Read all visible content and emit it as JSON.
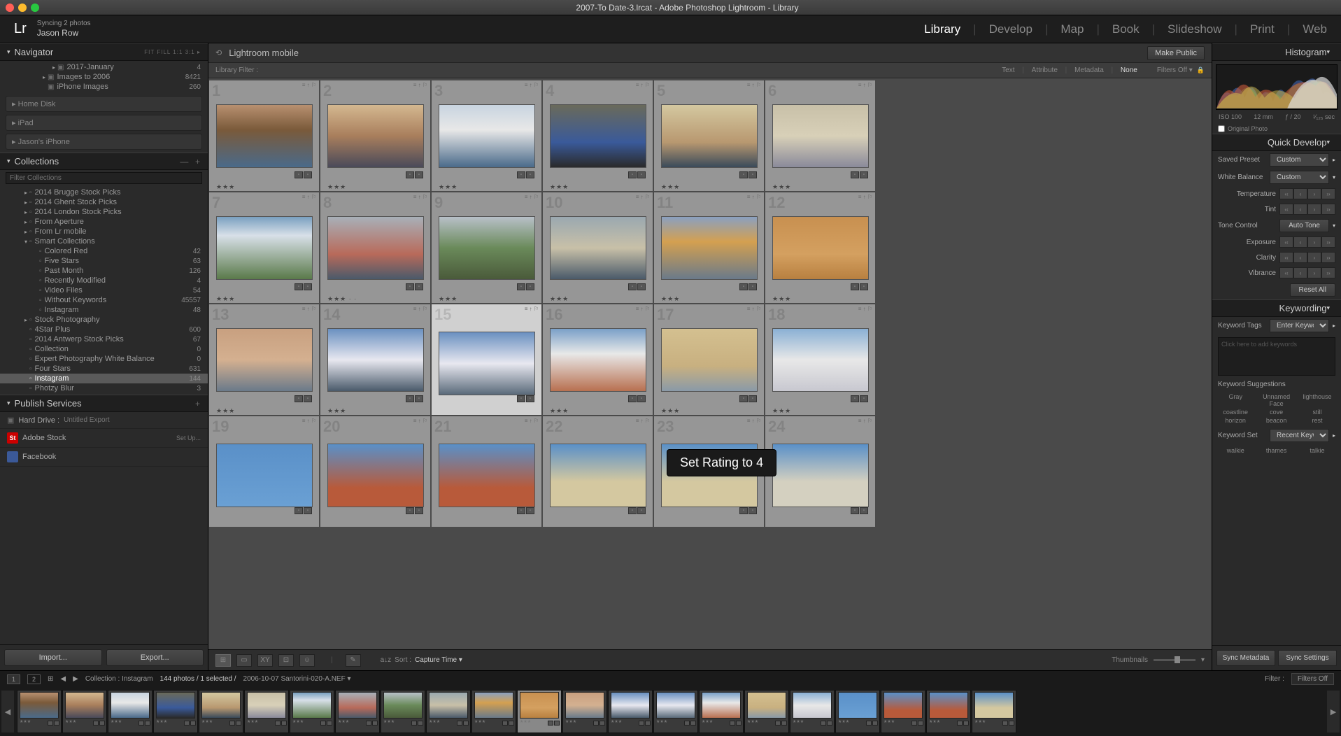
{
  "titlebar": {
    "title": "2007-To Date-3.lrcat - Adobe Photoshop Lightroom - Library"
  },
  "traffic_colors": {
    "close": "#ff5f57",
    "min": "#febc2e",
    "max": "#28c840"
  },
  "identity": {
    "sync": "Syncing 2 photos",
    "name": "Jason Row"
  },
  "logo": "Lr",
  "modules": [
    "Library",
    "Develop",
    "Map",
    "Book",
    "Slideshow",
    "Print",
    "Web"
  ],
  "active_module": "Library",
  "navigator": {
    "title": "Navigator",
    "extras": "FIT  FILL  1:1  3:1 ▸"
  },
  "folders": [
    {
      "indent": 3,
      "arrow": "▸",
      "label": "2017-January",
      "count": "4"
    },
    {
      "indent": 2,
      "arrow": "▸",
      "label": "Images to 2006",
      "count": "8421"
    },
    {
      "indent": 2,
      "arrow": "",
      "label": "iPhone Images",
      "count": "260"
    }
  ],
  "wells": [
    "Home Disk",
    "iPad",
    "Jason's iPhone"
  ],
  "collections": {
    "title": "Collections",
    "filter_placeholder": "Filter Collections",
    "items": [
      {
        "indent": 1,
        "arrow": "▸",
        "label": "2014 Brugge Stock Picks",
        "count": ""
      },
      {
        "indent": 1,
        "arrow": "▸",
        "label": "2014 Ghent Stock Picks",
        "count": ""
      },
      {
        "indent": 1,
        "arrow": "▸",
        "label": "2014 London Stock Picks",
        "count": ""
      },
      {
        "indent": 1,
        "arrow": "▸",
        "label": "From Aperture",
        "count": ""
      },
      {
        "indent": 1,
        "arrow": "▸",
        "label": "From Lr mobile",
        "count": ""
      },
      {
        "indent": 1,
        "arrow": "▾",
        "label": "Smart Collections",
        "count": ""
      },
      {
        "indent": 2,
        "arrow": "",
        "label": "Colored Red",
        "count": "42"
      },
      {
        "indent": 2,
        "arrow": "",
        "label": "Five Stars",
        "count": "63"
      },
      {
        "indent": 2,
        "arrow": "",
        "label": "Past Month",
        "count": "126"
      },
      {
        "indent": 2,
        "arrow": "",
        "label": "Recently Modified",
        "count": "4"
      },
      {
        "indent": 2,
        "arrow": "",
        "label": "Video Files",
        "count": "54"
      },
      {
        "indent": 2,
        "arrow": "",
        "label": "Without Keywords",
        "count": "45557"
      },
      {
        "indent": 2,
        "arrow": "",
        "label": "Instagram",
        "count": "48"
      },
      {
        "indent": 1,
        "arrow": "▸",
        "label": "Stock Photography",
        "count": ""
      },
      {
        "indent": 1,
        "arrow": "",
        "label": "4Star Plus",
        "count": "600"
      },
      {
        "indent": 1,
        "arrow": "",
        "label": "2014 Antwerp Stock Picks",
        "count": "67"
      },
      {
        "indent": 1,
        "arrow": "",
        "label": "Collection",
        "count": "0"
      },
      {
        "indent": 1,
        "arrow": "",
        "label": "Expert Photography White Balance",
        "count": "0"
      },
      {
        "indent": 1,
        "arrow": "",
        "label": "Four Stars",
        "count": "631"
      },
      {
        "indent": 1,
        "arrow": "",
        "label": "Instagram",
        "count": "144",
        "selected": true
      },
      {
        "indent": 1,
        "arrow": "",
        "label": "Photzy Blur",
        "count": "3"
      }
    ]
  },
  "publish": {
    "title": "Publish Services",
    "items": [
      {
        "label": "Hard Drive :",
        "sub": "Untitled Export"
      },
      {
        "label": "Adobe Stock",
        "setup": "Set Up..."
      },
      {
        "label": "Facebook",
        "sub": ""
      }
    ]
  },
  "import_btn": "Import...",
  "export_btn": "Export...",
  "crumb": {
    "back_icon": "⟲",
    "text": "Lightroom mobile",
    "make_public": "Make Public"
  },
  "library_filter": {
    "label": "Library Filter :",
    "opts": [
      "Text",
      "Attribute",
      "Metadata",
      "None"
    ],
    "active": "None",
    "filters_off": "Filters Off ▾"
  },
  "thumbs": [
    {
      "n": 1,
      "g": "linear-gradient(#b89070,#7a5a3a 40%,#4a6a8a)",
      "stars": "★★★"
    },
    {
      "n": 2,
      "g": "linear-gradient(#d4b890,#a87e5c 50%,#4a4a5a)",
      "stars": "★★★"
    },
    {
      "n": 3,
      "g": "linear-gradient(#c8d4e0,#e8e8e8 40%,#4a6a8a)",
      "stars": "★★★"
    },
    {
      "n": 4,
      "g": "linear-gradient(#6a6a5a,#3a5a9a 60%,#2a2a2a)",
      "stars": "★★★"
    },
    {
      "n": 5,
      "g": "linear-gradient(#d4c8a0,#b89870 60%,#3a4a5a)",
      "stars": "★★★"
    },
    {
      "n": 6,
      "g": "linear-gradient(#c8c0a8,#d8d0b8 50%,#8a8a9a)",
      "stars": "★★★"
    },
    {
      "n": 7,
      "g": "linear-gradient(#7aa0c0,#d8e0e8 30%,#5a7a4a)",
      "stars": "★★★"
    },
    {
      "n": 8,
      "g": "linear-gradient(#a8b0b8,#b86a5a 60%,#4a5a6a)",
      "stars": "★★★ · ·"
    },
    {
      "n": 9,
      "g": "linear-gradient(#b8c0c8,#6a8a5a 50%,#4a5a3a)",
      "stars": "★★★"
    },
    {
      "n": 10,
      "g": "linear-gradient(#9aa8b0,#c8c0a8 50%,#4a5a6a)",
      "stars": "★★★"
    },
    {
      "n": 11,
      "g": "linear-gradient(#8aa0c0,#d4a050 40%,#6a7a8a)",
      "stars": "★★★"
    },
    {
      "n": 12,
      "g": "linear-gradient(#c89050,#d4a060 60%,#b88040)",
      "stars": "★★★"
    },
    {
      "n": 13,
      "g": "linear-gradient(#c8a080,#d4b090 50%,#6a7a8a)",
      "stars": "★★★"
    },
    {
      "n": 14,
      "g": "linear-gradient(#6a90c0,#e8e8f0 50%,#4a5a6a)",
      "stars": "★★★"
    },
    {
      "n": 15,
      "g": "linear-gradient(#6a90c0,#e8e8f0 50%,#5a6a7a)",
      "stars": "",
      "selected": true
    },
    {
      "n": 16,
      "g": "linear-gradient(#7aa0c8,#e8e8e8 40%,#b87050)",
      "stars": "★★★"
    },
    {
      "n": 17,
      "g": "linear-gradient(#d4c090,#c8b080 60%,#8a9aa8)",
      "stars": "★★★"
    },
    {
      "n": 18,
      "g": "linear-gradient(#8ab0d4,#e8e8e8 50%,#c8c8d0)",
      "stars": "★★★"
    },
    {
      "n": 19,
      "g": "linear-gradient(#5a90c8,#6aa0d4)",
      "stars": ""
    },
    {
      "n": 20,
      "g": "linear-gradient(#5a90c8,#b85a3a 70%)",
      "stars": ""
    },
    {
      "n": 21,
      "g": "linear-gradient(#5a90c8,#b85a3a 70%)",
      "stars": ""
    },
    {
      "n": 22,
      "g": "linear-gradient(#5a90c8,#d4c8a0 60%)",
      "stars": ""
    },
    {
      "n": 23,
      "g": "linear-gradient(#5a90c8,#d4c8a0 60%)",
      "stars": ""
    },
    {
      "n": 24,
      "g": "linear-gradient(#5a90c8,#d4d0c0 60%)",
      "stars": ""
    }
  ],
  "tooltip": "Set Rating to 4",
  "bottom_toolbar": {
    "sort_label": "Sort :",
    "sort_value": "Capture Time",
    "thumbnails": "Thumbnails"
  },
  "status": {
    "monitors": [
      "1",
      "2"
    ],
    "collection": "Collection : Instagram",
    "count": "144 photos / 1 selected /",
    "file": "2006-10-07 Santorini-020-A.NEF ▾",
    "filter_label": "Filter :",
    "filter_value": "Filters Off"
  },
  "filmstrip_count": 22,
  "filmstrip_selected": 11,
  "histogram": {
    "title": "Histogram",
    "iso": "ISO 100",
    "focal": "12 mm",
    "aperture": "ƒ / 20",
    "shutter": "¹⁄₁₂₅ sec",
    "original": "Original Photo"
  },
  "quick_develop": {
    "title": "Quick Develop",
    "preset_label": "Saved Preset",
    "preset_value": "Custom",
    "wb_label": "White Balance",
    "wb_value": "Custom",
    "temp": "Temperature",
    "tint": "Tint",
    "tone_label": "Tone Control",
    "auto_tone": "Auto Tone",
    "exposure": "Exposure",
    "clarity": "Clarity",
    "vibrance": "Vibrance",
    "reset": "Reset All"
  },
  "keywording": {
    "title": "Keywording",
    "tags_label": "Keyword Tags",
    "tags_value": "Enter Keywords",
    "placeholder": "Click here to add keywords",
    "sugg_label": "Keyword Suggestions",
    "sugg": [
      "Gray",
      "Unnamed Face",
      "lighthouse",
      "coastline",
      "cove",
      "still",
      "horizon",
      "beacon",
      "rest"
    ],
    "set_label": "Keyword Set",
    "set_value": "Recent Keywo...",
    "set_items": [
      "walkie",
      "thames",
      "talkie"
    ]
  },
  "sync": {
    "meta": "Sync Metadata",
    "settings": "Sync Settings"
  }
}
